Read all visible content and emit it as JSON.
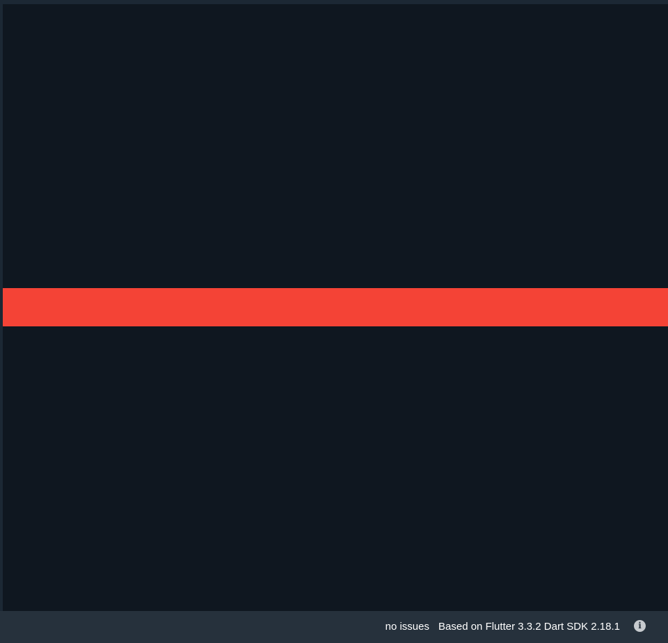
{
  "output": {
    "bar_color": "#f44336",
    "background_color": "#0f1720"
  },
  "status_bar": {
    "issues_text": "no issues",
    "version_text": "Based on Flutter 3.3.2 Dart SDK 2.18.1",
    "info_icon": "info-icon",
    "info_glyph": "i"
  }
}
